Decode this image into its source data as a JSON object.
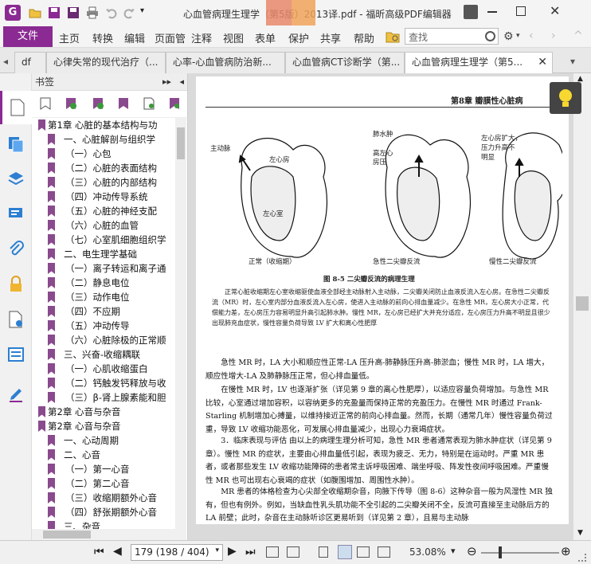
{
  "window": {
    "title": "心血管病理生理学（第5版）2013译.pdf - 福昕高级PDF编辑器"
  },
  "ribbon": {
    "file_label": "文件",
    "menus": [
      "主页",
      "转换",
      "编辑",
      "页面管",
      "注释",
      "视图",
      "表单",
      "保护",
      "共享",
      "帮助"
    ],
    "search_placeholder": "查找"
  },
  "tabs": [
    {
      "label": "df"
    },
    {
      "label": "心律失常的现代治疗（..."
    },
    {
      "label": "心率-心血管病防治新..."
    },
    {
      "label": "心血管病CT诊断学（第..."
    },
    {
      "label": "心血管病理生理学（第5..."
    }
  ],
  "bookmarks": {
    "title": "书签",
    "items": [
      {
        "label": "第1章  心脏的基本结构与功",
        "level": 1
      },
      {
        "label": "一、心脏解剖与组织学",
        "level": 2
      },
      {
        "label": "（一）心包",
        "level": 3
      },
      {
        "label": "（二）心脏的表面结构",
        "level": 3
      },
      {
        "label": "（三）心脏的内部结构",
        "level": 3
      },
      {
        "label": "（四）冲动传导系统",
        "level": 3
      },
      {
        "label": "（五）心脏的神经支配",
        "level": 3
      },
      {
        "label": "（六）心脏的血管",
        "level": 3
      },
      {
        "label": "（七）心室肌细胞组织学",
        "level": 3
      },
      {
        "label": "二、电生理学基础",
        "level": 2
      },
      {
        "label": "（一）离子转运和离子通",
        "level": 3
      },
      {
        "label": "（二）静息电位",
        "level": 3
      },
      {
        "label": "（三）动作电位",
        "level": 3
      },
      {
        "label": "（四）不应期",
        "level": 3
      },
      {
        "label": "（五）冲动传导",
        "level": 3
      },
      {
        "label": "（六）心脏除极的正常顺",
        "level": 3
      },
      {
        "label": "三、兴奋-收缩耦联",
        "level": 2
      },
      {
        "label": "（一）心肌收缩蛋白",
        "level": 3
      },
      {
        "label": "（二）钙触发钙释放与收",
        "level": 3
      },
      {
        "label": "（三）β-肾上腺素能和胆",
        "level": 3
      },
      {
        "label": "第2章  心音与杂音",
        "level": 1
      },
      {
        "label": "第2章  心音与杂音",
        "level": 1
      },
      {
        "label": "一、心动周期",
        "level": 2
      },
      {
        "label": "二、心音",
        "level": 2
      },
      {
        "label": "（一）第一心音",
        "level": 3
      },
      {
        "label": "（二）第二心音",
        "level": 3
      },
      {
        "label": "（三）收缩期额外心音",
        "level": 3
      },
      {
        "label": "（四）舒张期额外心音",
        "level": 3
      },
      {
        "label": "三、杂音",
        "level": 2
      }
    ]
  },
  "document": {
    "header": "第8章    瓣膜性心脏病",
    "figure": {
      "labels": {
        "aorta": "主动脉",
        "left_atrium": "左心房",
        "left_ventricle": "左心室",
        "pulmonary_edema": "肺水肿",
        "high_la_pressure": "高左心\n房压",
        "enlarged_la": "左心房扩大，\n压力升高不\n明显",
        "normal": "正常（收缩期）",
        "acute": "急性二尖瓣反流",
        "chronic": "慢性二尖瓣反流"
      },
      "caption": "图 8-5   二尖瓣反流的病理生理",
      "note": "正常心脏收缩期左心室收缩驱使血液全部经主动脉射入主动脉，二尖瓣关闭防止血液反流入左心房。在急性二尖瓣反流（MR）时，左心室内部分血液反流入左心房，使进入主动脉的前向心排血量减少。在急性 MR，左心房大小正常，代偿能力差，左心房压力容易明显升高引起肺水肿。慢性 MR，左心房已经扩大并充分适应，左心房压力升高不明显且很少出现肺充血症状，慢性容量负荷导致 LV 扩大和离心性肥厚"
    },
    "body": [
      "急性 MR 时，LA 大小和顺应性正常-LA 压升高-肺静脉压升高-肺淤血；慢性 MR 时，LA 增大，顺应性增大-LA 及肺静脉压正常，但心排血量低。",
      "在慢性 MR 时，LV 也逐渐扩张（详见第 9 章的离心性肥厚），以适应容量负荷增加。与急性 MR 比较，心室通过增加容积，以容纳更多的充盈量而保持正常的充盈压力。在慢性 MR 时通过 Frank-Starling 机制增加心搏量，以维持接近正常的前向心排血量。然而，长期（通常几年）慢性容量负荷过重，导致 LV 收缩功能恶化，可发展心排血量减少，出现心力衰竭症状。",
      "3．临床表现与评估   由以上的病理生理分析可知，急性 MR 患者通常表现为肺水肿症状（详见第 9 章）。慢性 MR 的症状，主要由心排血量低引起，表现为疲乏、无力，特别是在运动时。严重 MR 患者，或者那些发生 LV 收缩功能障碍的患者常主诉呼吸困难、端坐呼吸、阵发性夜间呼吸困难。严重慢性 MR 也可出现右心衰竭的症状（如腹围增加、周围性水肿）。",
      "MR 患者的体格检查为心尖部全收缩期杂音，向腋下传导（图 8-6）这种杂音一般为风湿性 MR 独有，但也有例外。例如，当缺血性乳头肌功能不全引起的二尖瓣关闭不全，反流可直接至主动脉后方的 LA 前壁；此时，杂音在主动脉听诊区更易听到（详见第 2 章），且易与主动脉"
    ]
  },
  "statusbar": {
    "page_value": "179 (198 / 404)",
    "zoom": "53.08%"
  }
}
